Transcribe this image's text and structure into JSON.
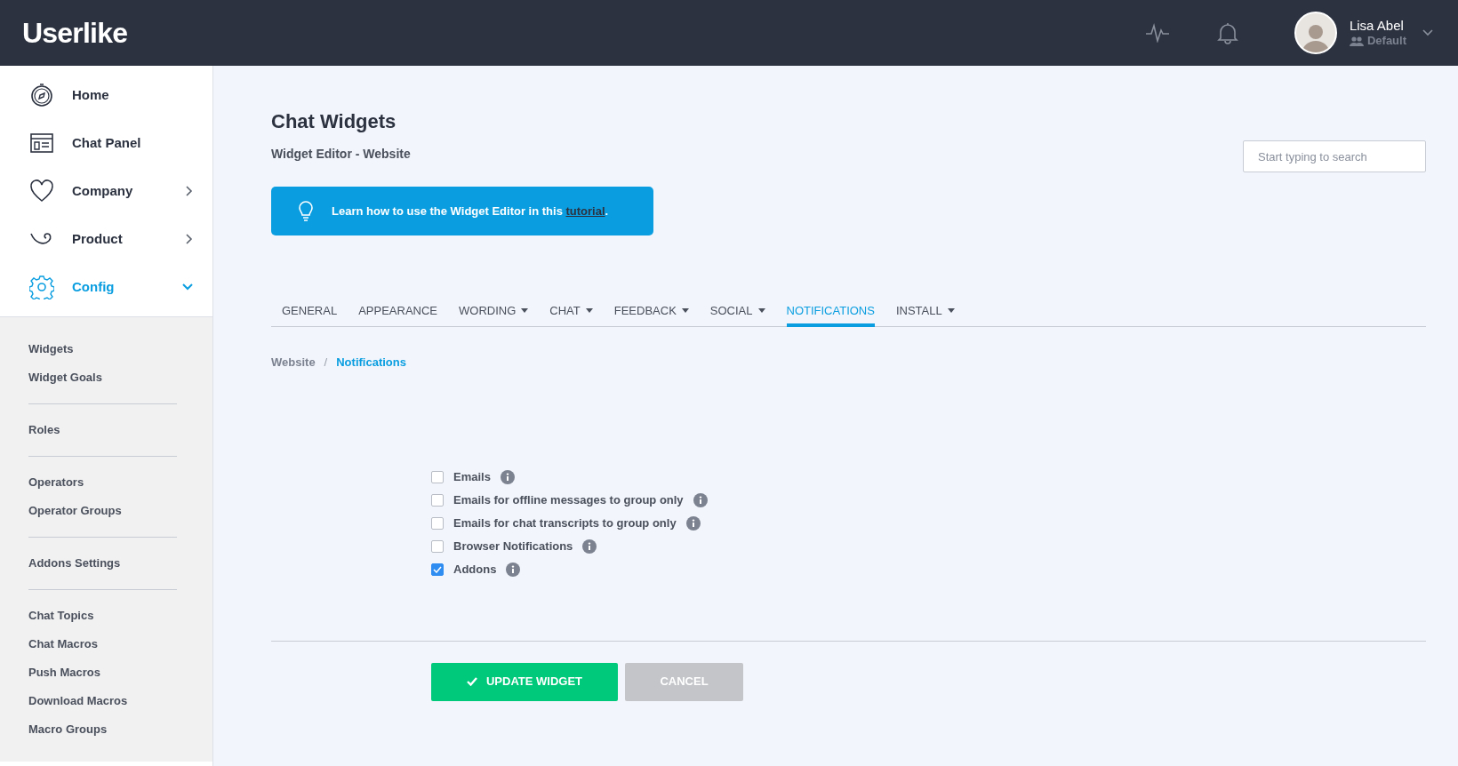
{
  "header": {
    "logo": "Userlike",
    "user": {
      "name": "Lisa Abel",
      "group": "Default"
    }
  },
  "sidebar": {
    "items": [
      {
        "label": "Home",
        "selected": false,
        "kind": "link"
      },
      {
        "label": "Chat Panel",
        "selected": false,
        "kind": "link"
      },
      {
        "label": "Company",
        "selected": false,
        "kind": "group",
        "expanded": false
      },
      {
        "label": "Product",
        "selected": false,
        "kind": "group",
        "expanded": false
      },
      {
        "label": "Config",
        "selected": true,
        "kind": "group",
        "expanded": true
      }
    ],
    "subgroups": [
      [
        "Widgets",
        "Widget Goals"
      ],
      [
        "Roles"
      ],
      [
        "Operators",
        "Operator Groups"
      ],
      [
        "Addons Settings"
      ],
      [
        "Chat Topics",
        "Chat Macros",
        "Push Macros",
        "Download Macros",
        "Macro Groups"
      ]
    ]
  },
  "page": {
    "title": "Chat Widgets",
    "subtitle": "Widget Editor - Website",
    "search": {
      "placeholder": "Start typing to search"
    },
    "banner": {
      "text_before": "Learn how to use the Widget Editor in this ",
      "link": "tutorial",
      "text_after": "."
    }
  },
  "tabs": [
    {
      "label": "GENERAL",
      "selected": false,
      "dropdown": false
    },
    {
      "label": "APPEARANCE",
      "selected": false,
      "dropdown": false
    },
    {
      "label": "WORDING",
      "selected": false,
      "dropdown": true
    },
    {
      "label": "CHAT",
      "selected": false,
      "dropdown": true
    },
    {
      "label": "FEEDBACK",
      "selected": false,
      "dropdown": true
    },
    {
      "label": "SOCIAL",
      "selected": false,
      "dropdown": true
    },
    {
      "label": "NOTIFICATIONS",
      "selected": true,
      "dropdown": false
    },
    {
      "label": "INSTALL",
      "selected": false,
      "dropdown": true
    }
  ],
  "breadcrumb_separator": "/",
  "breadcrumb": [
    {
      "label": "Website",
      "current": false
    },
    {
      "label": "Notifications",
      "current": true
    }
  ],
  "options": [
    {
      "label": "Emails",
      "checked": false
    },
    {
      "label": "Emails for offline messages to group only",
      "checked": false
    },
    {
      "label": "Emails for chat transcripts to group only",
      "checked": false
    },
    {
      "label": "Browser Notifications",
      "checked": false
    },
    {
      "label": "Addons",
      "checked": true
    }
  ],
  "buttons": [
    {
      "label": "UPDATE WIDGET",
      "kind": "primary"
    },
    {
      "label": "CANCEL",
      "kind": "secondary"
    }
  ]
}
